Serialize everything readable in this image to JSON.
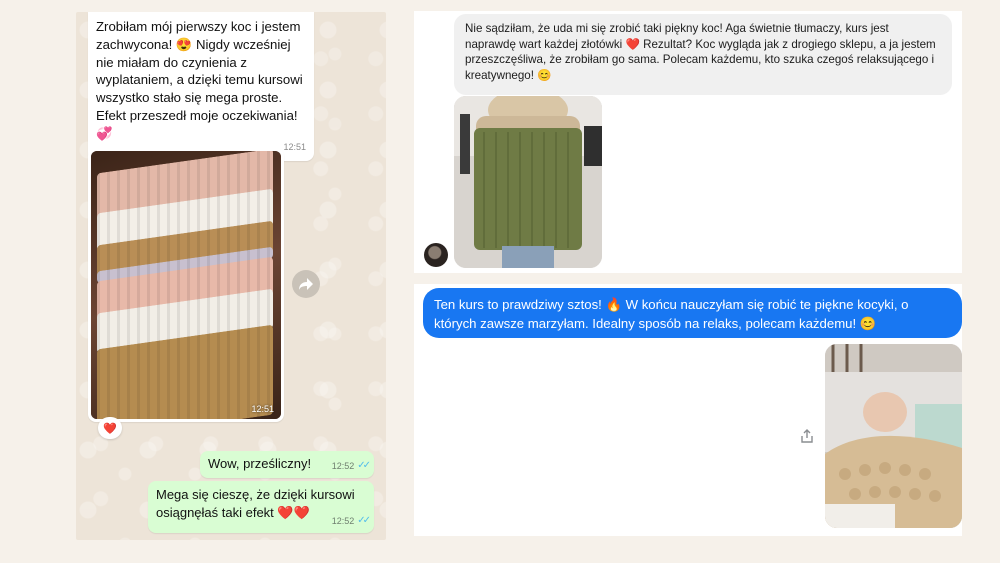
{
  "whatsapp": {
    "incoming_message": "Zrobiłam mój pierwszy koc i jestem zachwycona! 😍 Nigdy wcześniej nie miałam do czynienia z wyplataniem, a dzięki temu kursowi wszystko stało się mega proste. Efekt przeszedł moje oczekiwania! 💞",
    "incoming_time": "12:51",
    "photo_time": "12:51",
    "reaction": "❤️",
    "outgoing": [
      {
        "text": "Wow, prześliczny!",
        "time": "12:52"
      },
      {
        "text": "Mega się cieszę, że dzięki kursowi osiągnęłaś taki efekt ❤️❤️",
        "time": "12:52"
      }
    ],
    "read_ticks": "✓✓"
  },
  "review_top": {
    "message": "Nie sądziłam, że uda mi się zrobić taki piękny koc! Aga świetnie tłumaczy, kurs jest naprawdę wart każdej złotówki ❤️ Rezultat? Koc wygląda jak z drogiego sklepu, a ja jestem przeszczęśliwa, że zrobiłam go sama. Polecam każdemu, kto szuka czegoś relaksującego i kreatywnego! 😊"
  },
  "review_bottom": {
    "message": "Ten kurs to prawdziwy sztos! 🔥 W końcu nauczyłam się robić te piękne kocyki, o których zawsze marzyłam. Idealny sposób na relaks, polecam każdemu! 😊"
  },
  "colors": {
    "whatsapp_out": "#d9fdd3",
    "messenger_blue": "#1877f2",
    "page_bg": "#f6f1ea"
  }
}
